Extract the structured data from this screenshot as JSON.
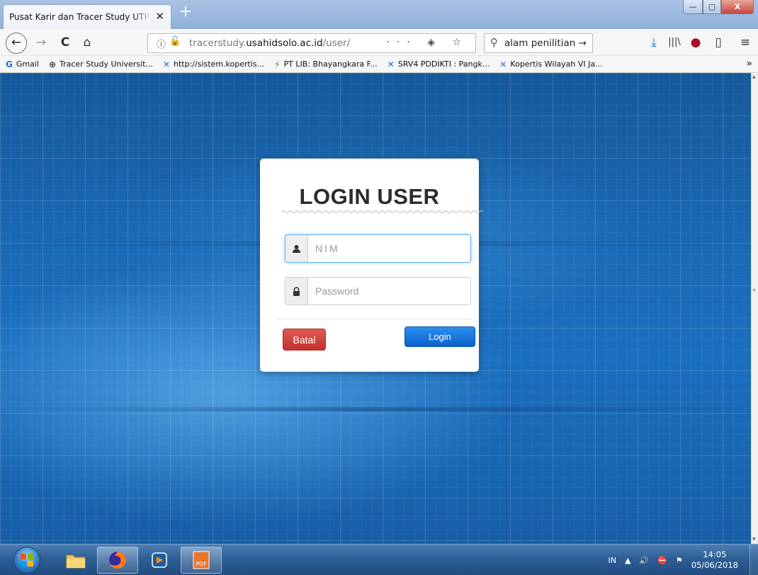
{
  "browser": {
    "tab": {
      "title": "Pusat Karir dan Tracer Study UTP Surakarta",
      "close": "✕"
    },
    "new_tab": "+",
    "window": {
      "minimize": "—",
      "maximize": "▢",
      "close": "X"
    },
    "nav": {
      "back": "←",
      "forward": "→",
      "reload": "C",
      "home": "⌂",
      "url_info": "ⓘ",
      "url_lock": "🔓",
      "url_prefix": "tracerstudy.",
      "url_domain": "usahidsolo.ac.id",
      "url_path": "/user/",
      "page_actions": "··· ◈ ☆",
      "search_value": "alam penilitian →",
      "toolbar": {
        "download": "⤓",
        "library": "|||\\",
        "ublock": "●",
        "sidebar": "▯",
        "menu": "≡"
      }
    },
    "bookmarks": [
      {
        "label": "Gmail",
        "icon": "G"
      },
      {
        "label": "Tracer Study Universit...",
        "icon": "⊕"
      },
      {
        "label": "http://sistem.kopertis...",
        "icon": "✕"
      },
      {
        "label": "PT LIB: Bhayangkara F...",
        "icon": "⚡"
      },
      {
        "label": "SRV4 PDDIKTI : Pangk...",
        "icon": "✕"
      },
      {
        "label": "Kopertis Wilayah VI Ja...",
        "icon": "✕"
      }
    ],
    "bookmarks_more": "»"
  },
  "login": {
    "title": "LOGIN USER",
    "nim_placeholder": "NIM",
    "password_placeholder": "Password",
    "cancel_label": "Batal",
    "submit_label": "Login"
  },
  "taskbar": {
    "tray": {
      "language": "IN",
      "chevron": "▲",
      "volume": "🔊",
      "network": "⛔",
      "action_center": "⚑"
    },
    "clock_time": "14:05",
    "clock_date": "05/06/2018"
  },
  "colors": {
    "background_blue": "#1b6fbf",
    "login_button": "#0a62c9",
    "cancel_button": "#c5302b",
    "title_text": "#2c2c2c"
  }
}
